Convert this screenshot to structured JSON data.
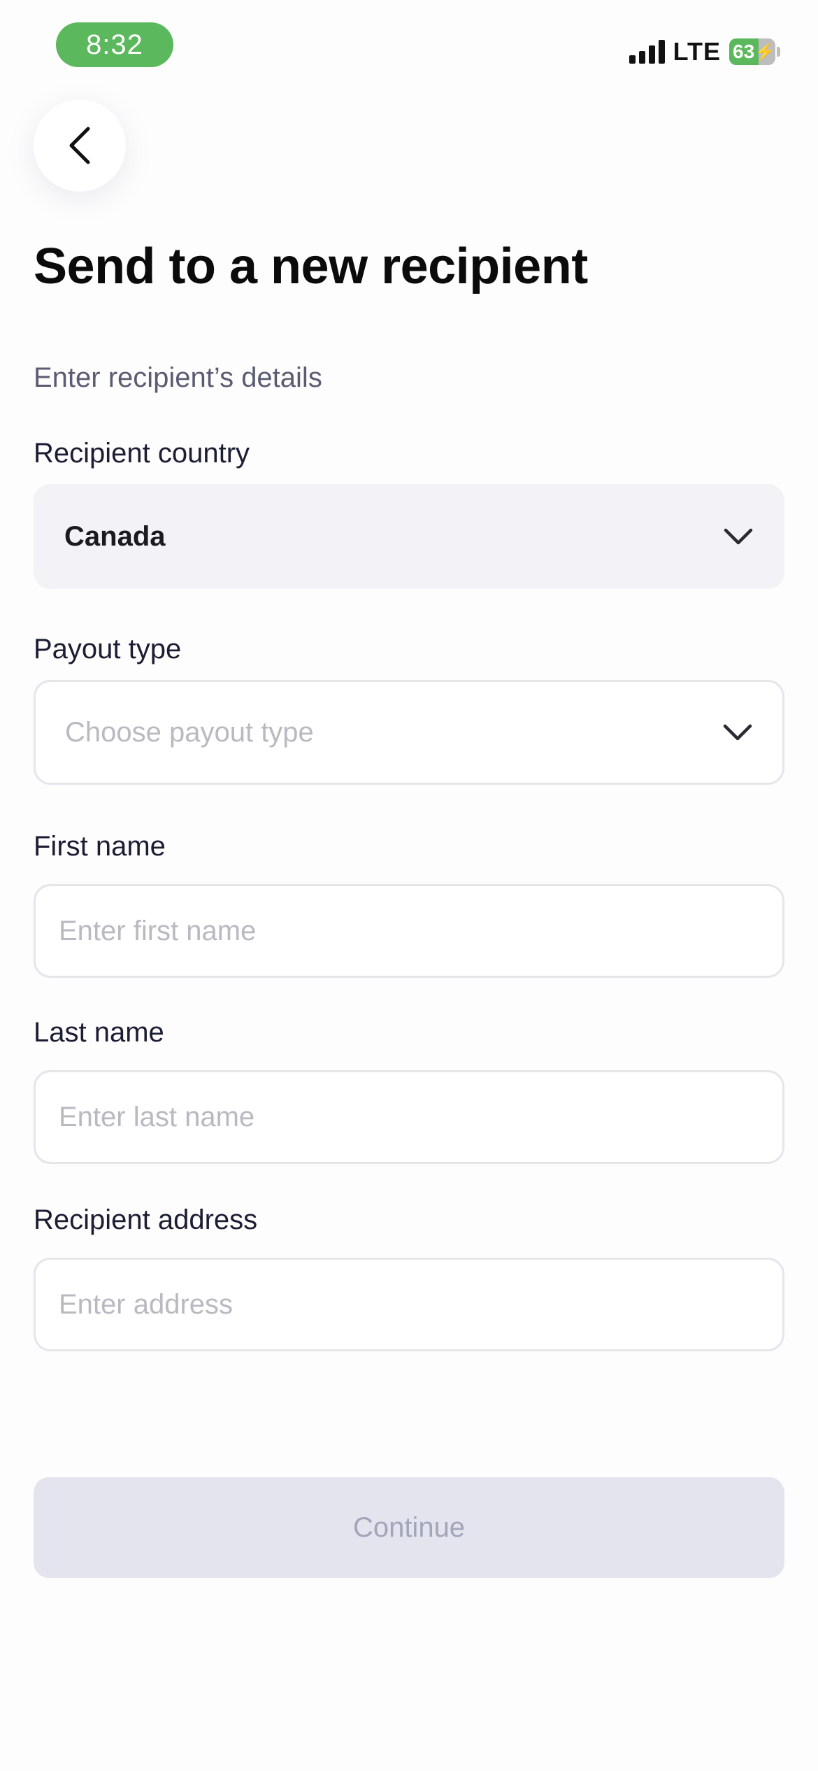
{
  "status_bar": {
    "time": "8:32",
    "network": "LTE",
    "battery_level": "63",
    "battery_charging": true
  },
  "header": {
    "back_icon": "chevron-left-icon",
    "title": "Send to a new recipient"
  },
  "form": {
    "subtitle": "Enter recipient’s details",
    "country": {
      "label": "Recipient country",
      "value": "Canada",
      "icon": "chevron-down-icon"
    },
    "payout_type": {
      "label": "Payout type",
      "placeholder": "Choose payout type",
      "icon": "chevron-down-icon"
    },
    "first_name": {
      "label": "First name",
      "placeholder": "Enter first name",
      "value": ""
    },
    "last_name": {
      "label": "Last name",
      "placeholder": "Enter last name",
      "value": ""
    },
    "address": {
      "label": "Recipient address",
      "placeholder": "Enter address",
      "value": ""
    }
  },
  "actions": {
    "continue_label": "Continue",
    "continue_enabled": false
  },
  "colors": {
    "time_pill": "#5cb85c",
    "battery_fill": "#5cb85c",
    "continue_disabled_bg": "#e3e4ed",
    "continue_disabled_text": "#a3a5bb",
    "input_border": "#e6e6ea",
    "select_filled_bg": "#f3f3f7"
  }
}
